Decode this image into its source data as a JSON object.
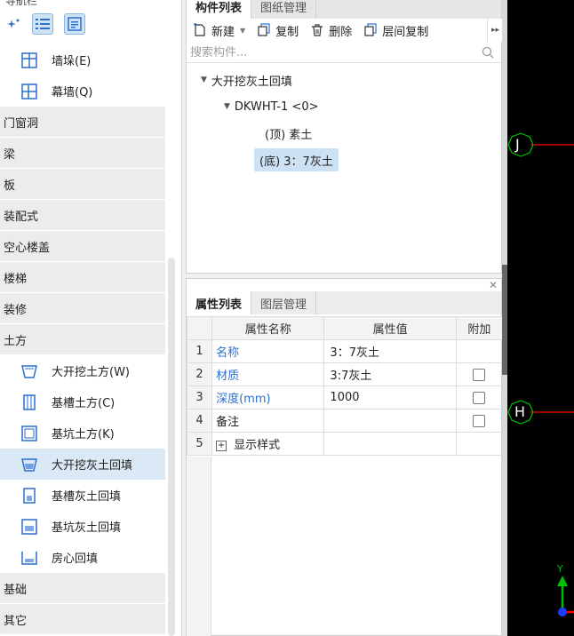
{
  "left_panel": {
    "header": "导航栏",
    "tool_icons": [
      "sparkle-icon",
      "list-icon",
      "detail-list-icon"
    ],
    "top_items": [
      {
        "label": "墙垛(E)",
        "icon": "wall-pier-icon"
      },
      {
        "label": "幕墙(Q)",
        "icon": "curtain-wall-icon"
      }
    ],
    "categories_a": [
      "门窗洞",
      "梁",
      "板",
      "装配式",
      "空心楼盖",
      "楼梯",
      "装修",
      "土方"
    ],
    "earthwork_items": [
      {
        "label": "大开挖土方(W)",
        "icon": "excavation-icon",
        "selected": false
      },
      {
        "label": "基槽土方(C)",
        "icon": "trench-icon",
        "selected": false
      },
      {
        "label": "基坑土方(K)",
        "icon": "pit-icon",
        "selected": false
      },
      {
        "label": "大开挖灰土回填",
        "icon": "excavation-backfill-icon",
        "selected": true
      },
      {
        "label": "基槽灰土回填",
        "icon": "trench-backfill-icon",
        "selected": false
      },
      {
        "label": "基坑灰土回填",
        "icon": "pit-backfill-icon",
        "selected": false
      },
      {
        "label": "房心回填",
        "icon": "room-backfill-icon",
        "selected": false
      }
    ],
    "categories_b": [
      "基础",
      "其它"
    ]
  },
  "component_pane": {
    "tabs": [
      "构件列表",
      "图纸管理"
    ],
    "toolbar": {
      "new_label": "新建",
      "copy_label": "复制",
      "delete_label": "删除",
      "floor_copy_label": "层间复制"
    },
    "search_placeholder": "搜索构件...",
    "tree": {
      "root": "大开挖灰土回填",
      "child": "DKWHT-1 <0>",
      "top_layer": "(顶)  素土",
      "bottom_layer": "(底)  3：7灰土"
    }
  },
  "property_pane": {
    "tabs": [
      "属性列表",
      "图层管理"
    ],
    "columns": [
      "属性名称",
      "属性值",
      "附加"
    ],
    "rows": [
      {
        "idx": "1",
        "name": "名称",
        "value": "3：7灰土"
      },
      {
        "idx": "2",
        "name": "材质",
        "value": "3:7灰土"
      },
      {
        "idx": "3",
        "name": "深度(mm)",
        "value": "1000"
      },
      {
        "idx": "4",
        "name": "备注",
        "value": ""
      },
      {
        "idx": "5",
        "name": "显示样式",
        "value": ""
      }
    ]
  },
  "canvas": {
    "axis_labels": [
      "J",
      "H"
    ],
    "coord_label": "Y",
    "axis_color": "#ff0000",
    "bubble_color": "#00c000"
  }
}
